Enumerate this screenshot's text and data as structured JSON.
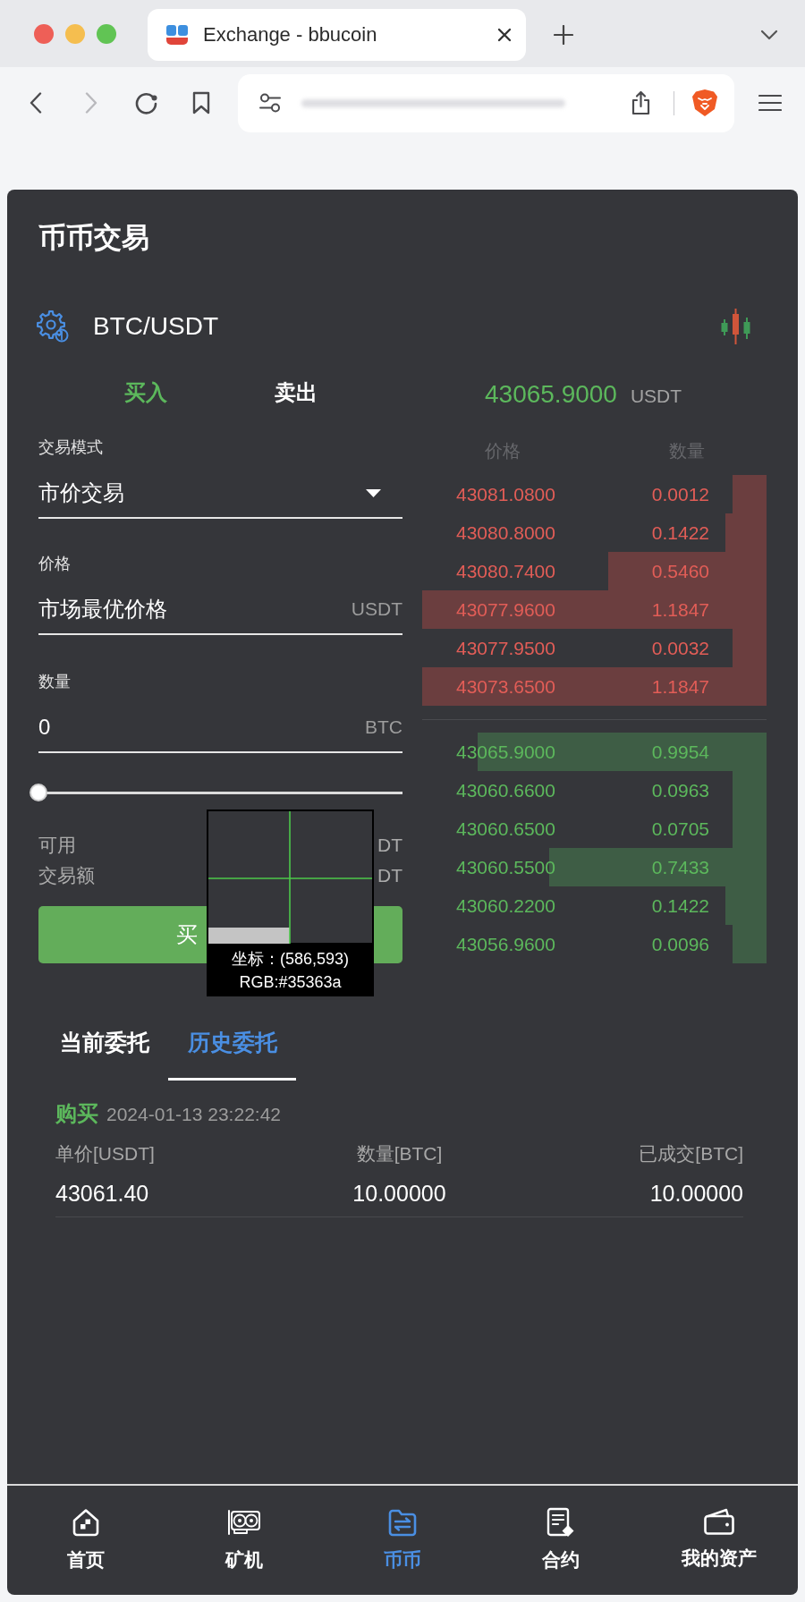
{
  "browser": {
    "tab": {
      "title": "Exchange - bbucoin"
    }
  },
  "page_title": "币币交易",
  "pair": {
    "symbol": "BTC/USDT"
  },
  "trade_tabs": [
    {
      "label": "买入",
      "selected": true
    },
    {
      "label": "卖出",
      "selected": false
    }
  ],
  "last_price": {
    "value": "43065.9000",
    "unit": "USDT"
  },
  "order_form": {
    "mode": {
      "label": "交易模式",
      "value": "市价交易"
    },
    "price": {
      "label": "价格",
      "value": "市场最优价格",
      "unit": "USDT"
    },
    "amount": {
      "label": "数量",
      "value": "0",
      "unit": "BTC"
    },
    "slider": {
      "level": 0
    },
    "available": {
      "label": "可用",
      "value": "DT"
    },
    "trade_amount": {
      "label": "交易额",
      "value": "DT"
    },
    "submit_button": "买"
  },
  "order_book": {
    "columns": [
      "价格",
      "数量"
    ],
    "asks": [
      {
        "price": "43081.0800",
        "quantity": "0.0012",
        "level": 0.1
      },
      {
        "price": "43080.8000",
        "quantity": "0.1422",
        "level": 0.12
      },
      {
        "price": "43080.7400",
        "quantity": "0.5460",
        "level": 0.46
      },
      {
        "price": "43077.9600",
        "quantity": "1.1847",
        "level": 1
      },
      {
        "price": "43077.9500",
        "quantity": "0.0032",
        "level": 0.1
      },
      {
        "price": "43073.6500",
        "quantity": "1.1847",
        "level": 1
      }
    ],
    "bids": [
      {
        "price": "43065.9000",
        "quantity": "0.9954",
        "level": 0.84
      },
      {
        "price": "43060.6600",
        "quantity": "0.0963",
        "level": 0.1
      },
      {
        "price": "43060.6500",
        "quantity": "0.0705",
        "level": 0.1
      },
      {
        "price": "43060.5500",
        "quantity": "0.7433",
        "level": 0.63
      },
      {
        "price": "43060.2200",
        "quantity": "0.1422",
        "level": 0.12
      },
      {
        "price": "43056.9600",
        "quantity": "0.0096",
        "level": 0.1
      }
    ]
  },
  "order_tabs": [
    {
      "label": "当前委托",
      "selected": false
    },
    {
      "label": "历史委托",
      "selected": true
    }
  ],
  "orders": [
    {
      "side": "购买",
      "kind": "buy",
      "time": "2024-01-13 23:22:42",
      "fields": [
        {
          "label": "单价[USDT]",
          "value": "43061.40"
        },
        {
          "label": "数量[BTC]",
          "value": "10.00000"
        },
        {
          "label": "已成交[BTC]",
          "value": "10.00000"
        }
      ]
    }
  ],
  "bottom_nav": [
    {
      "label": "首页",
      "selected": false
    },
    {
      "label": "矿机",
      "selected": false
    },
    {
      "label": "币币",
      "selected": true
    },
    {
      "label": "合约",
      "selected": false
    },
    {
      "label": "我的资产",
      "selected": false
    }
  ],
  "color_picker": {
    "coordinates": "坐标：(586,593)",
    "color_value": "RGB:#35363a"
  }
}
